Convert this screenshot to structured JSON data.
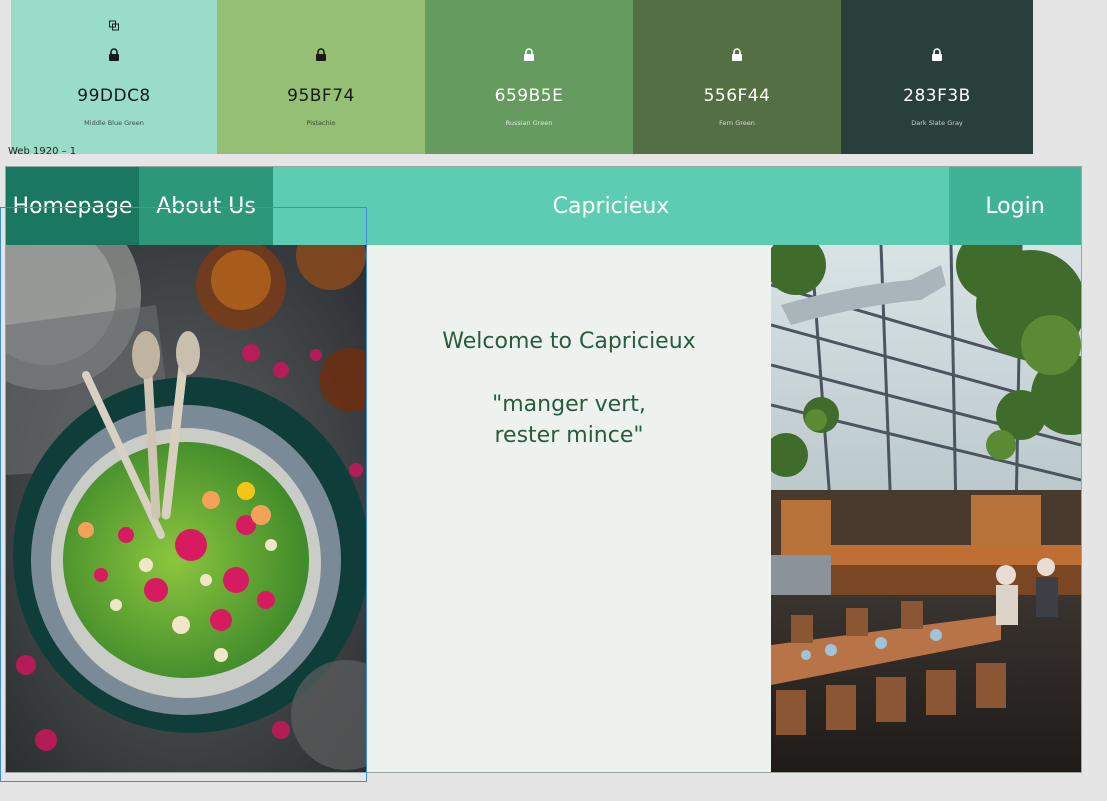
{
  "palette": [
    {
      "hex": "99DDC8",
      "name": "Middle Blue Green",
      "bg": "#99DDC8",
      "fg": "#1a1a1a",
      "locked": true,
      "copy_icon": true
    },
    {
      "hex": "95BF74",
      "name": "Pistachio",
      "bg": "#95BF74",
      "fg": "#1a1a1a",
      "locked": true,
      "copy_icon": false
    },
    {
      "hex": "659B5E",
      "name": "Russian Green",
      "bg": "#659B5E",
      "fg": "#ffffff",
      "locked": true,
      "copy_icon": false
    },
    {
      "hex": "556F44",
      "name": "Fern Green",
      "bg": "#556F44",
      "fg": "#ffffff",
      "locked": true,
      "copy_icon": false
    },
    {
      "hex": "283F3B",
      "name": "Dark Slate Gray",
      "bg": "#283F3B",
      "fg": "#ffffff",
      "locked": true,
      "copy_icon": false
    }
  ],
  "frame_label": "Web 1920 – 1",
  "nav": {
    "home": "Homepage",
    "about": "About Us",
    "title": "Capricieux",
    "login": "Login"
  },
  "hero": {
    "welcome": "Welcome to Capricieux",
    "motto_line1": "\"manger vert,",
    "motto_line2": "rester mince\""
  },
  "images": {
    "left": "salad-bowl-photo",
    "right": "greenhouse-restaurant-photo"
  },
  "colors": {
    "nav_bg": "#5ccdb2",
    "nav_home": "#1a7860",
    "nav_about": "#2d977a",
    "nav_login": "#40b396",
    "content_bg": "#eef2ef",
    "text_green": "#285c3c"
  }
}
